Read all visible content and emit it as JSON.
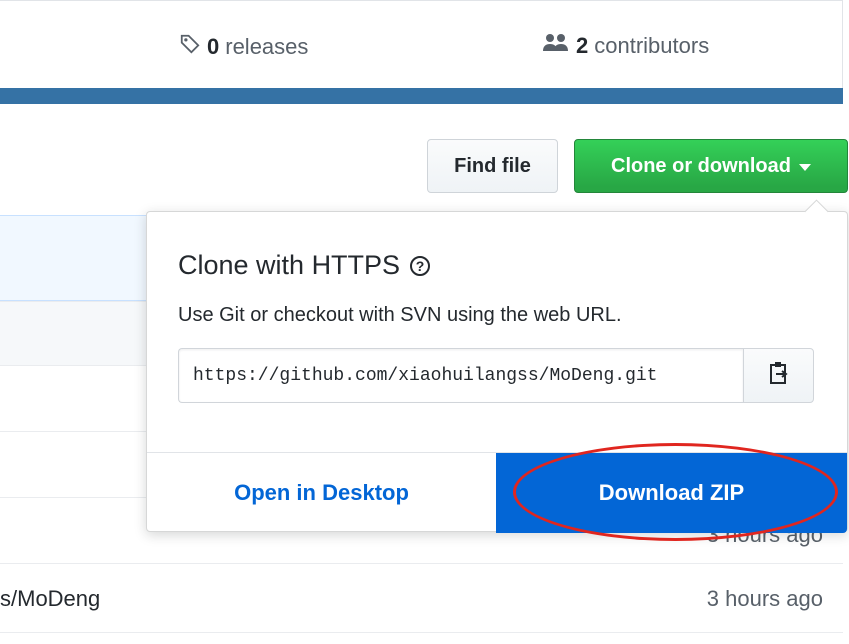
{
  "summary": {
    "releases": {
      "count": "0",
      "label": "releases",
      "icon": "tag-icon"
    },
    "contributors": {
      "count": "2",
      "label": "contributors",
      "icon": "people-icon"
    }
  },
  "language_bar_color": "#3572a5",
  "actions": {
    "find_file": "Find file",
    "clone_download": "Clone or download"
  },
  "file_rows": [
    {
      "name": "",
      "age": ""
    },
    {
      "name": "",
      "age": ""
    },
    {
      "name": "",
      "age": "3 hours ago"
    },
    {
      "name": "s/MoDeng",
      "age": "3 hours ago"
    }
  ],
  "clone_panel": {
    "title": "Clone with HTTPS",
    "help_icon": "question-icon",
    "description": "Use Git or checkout with SVN using the web URL.",
    "url": "https://github.com/xiaohuilangss/MoDeng.git",
    "copy_icon": "clipboard-icon",
    "open_desktop": "Open in Desktop",
    "download_zip": "Download ZIP"
  },
  "colors": {
    "clone_button": "#28a745",
    "download_button": "#0366d6",
    "annotation": "#e0261f"
  }
}
